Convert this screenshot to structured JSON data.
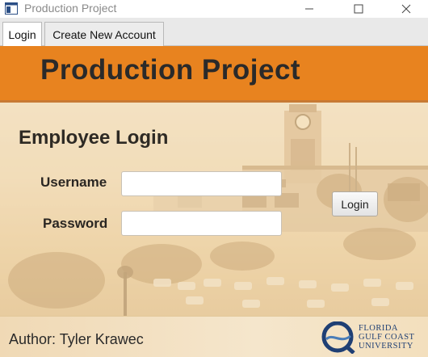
{
  "window": {
    "title": "Production Project"
  },
  "tabs": [
    {
      "label": "Login"
    },
    {
      "label": "Create New Account"
    }
  ],
  "header": {
    "title": "Production Project"
  },
  "login": {
    "heading": "Employee Login",
    "username_label": "Username",
    "password_label": "Password",
    "username_value": "",
    "password_value": "",
    "button_label": "Login"
  },
  "footer": {
    "author": "Author: Tyler Krawec",
    "logo_lines": [
      "FLORIDA",
      "GULF COAST",
      "UNIVERSITY"
    ]
  },
  "colors": {
    "banner": "#e8831f",
    "logo_blue": "#1f3f74"
  }
}
